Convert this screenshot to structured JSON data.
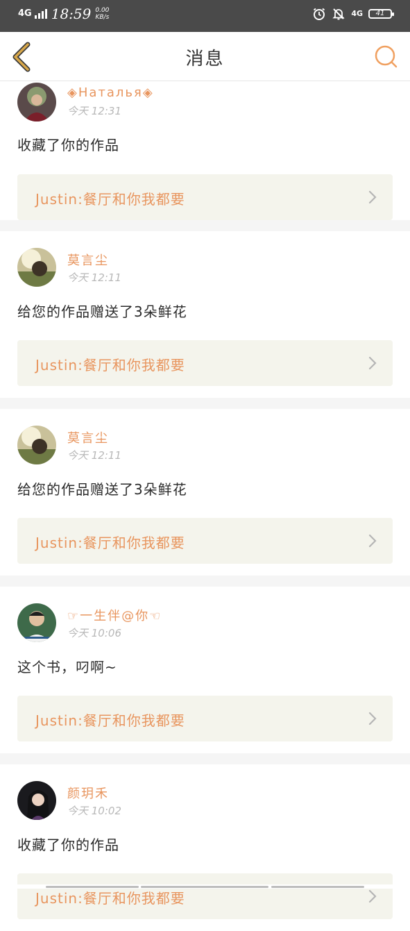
{
  "status_bar": {
    "network": "4G",
    "time": "18:59",
    "speed_value": "0.00",
    "speed_unit": "KB/s",
    "network_right": "4G",
    "battery": "41"
  },
  "header": {
    "title": "消息",
    "back_icon": "chevron-left-icon",
    "search_icon": "search-icon"
  },
  "colors": {
    "accent": "#e8955e",
    "card_bg": "#f4f4ec",
    "status_bar_bg": "#4a4a4a"
  },
  "messages": [
    {
      "username": "◈Наталья◈",
      "time": "今天 12:31",
      "content": "收藏了你的作品",
      "work": "Justin:餐厅和你我都要"
    },
    {
      "username": "莫言尘",
      "time": "今天 12:11",
      "content": "给您的作品赠送了3朵鲜花",
      "work": "Justin:餐厅和你我都要"
    },
    {
      "username": "莫言尘",
      "time": "今天 12:11",
      "content": "给您的作品赠送了3朵鲜花",
      "work": "Justin:餐厅和你我都要"
    },
    {
      "username": "☞一生伴@你☜",
      "time": "今天 10:06",
      "content": "这个书，叼啊~",
      "work": "Justin:餐厅和你我都要"
    },
    {
      "username": "颜玥禾",
      "time": "今天 10:02",
      "content": "收藏了你的作品",
      "work": "Justin:餐厅和你我都要"
    }
  ]
}
